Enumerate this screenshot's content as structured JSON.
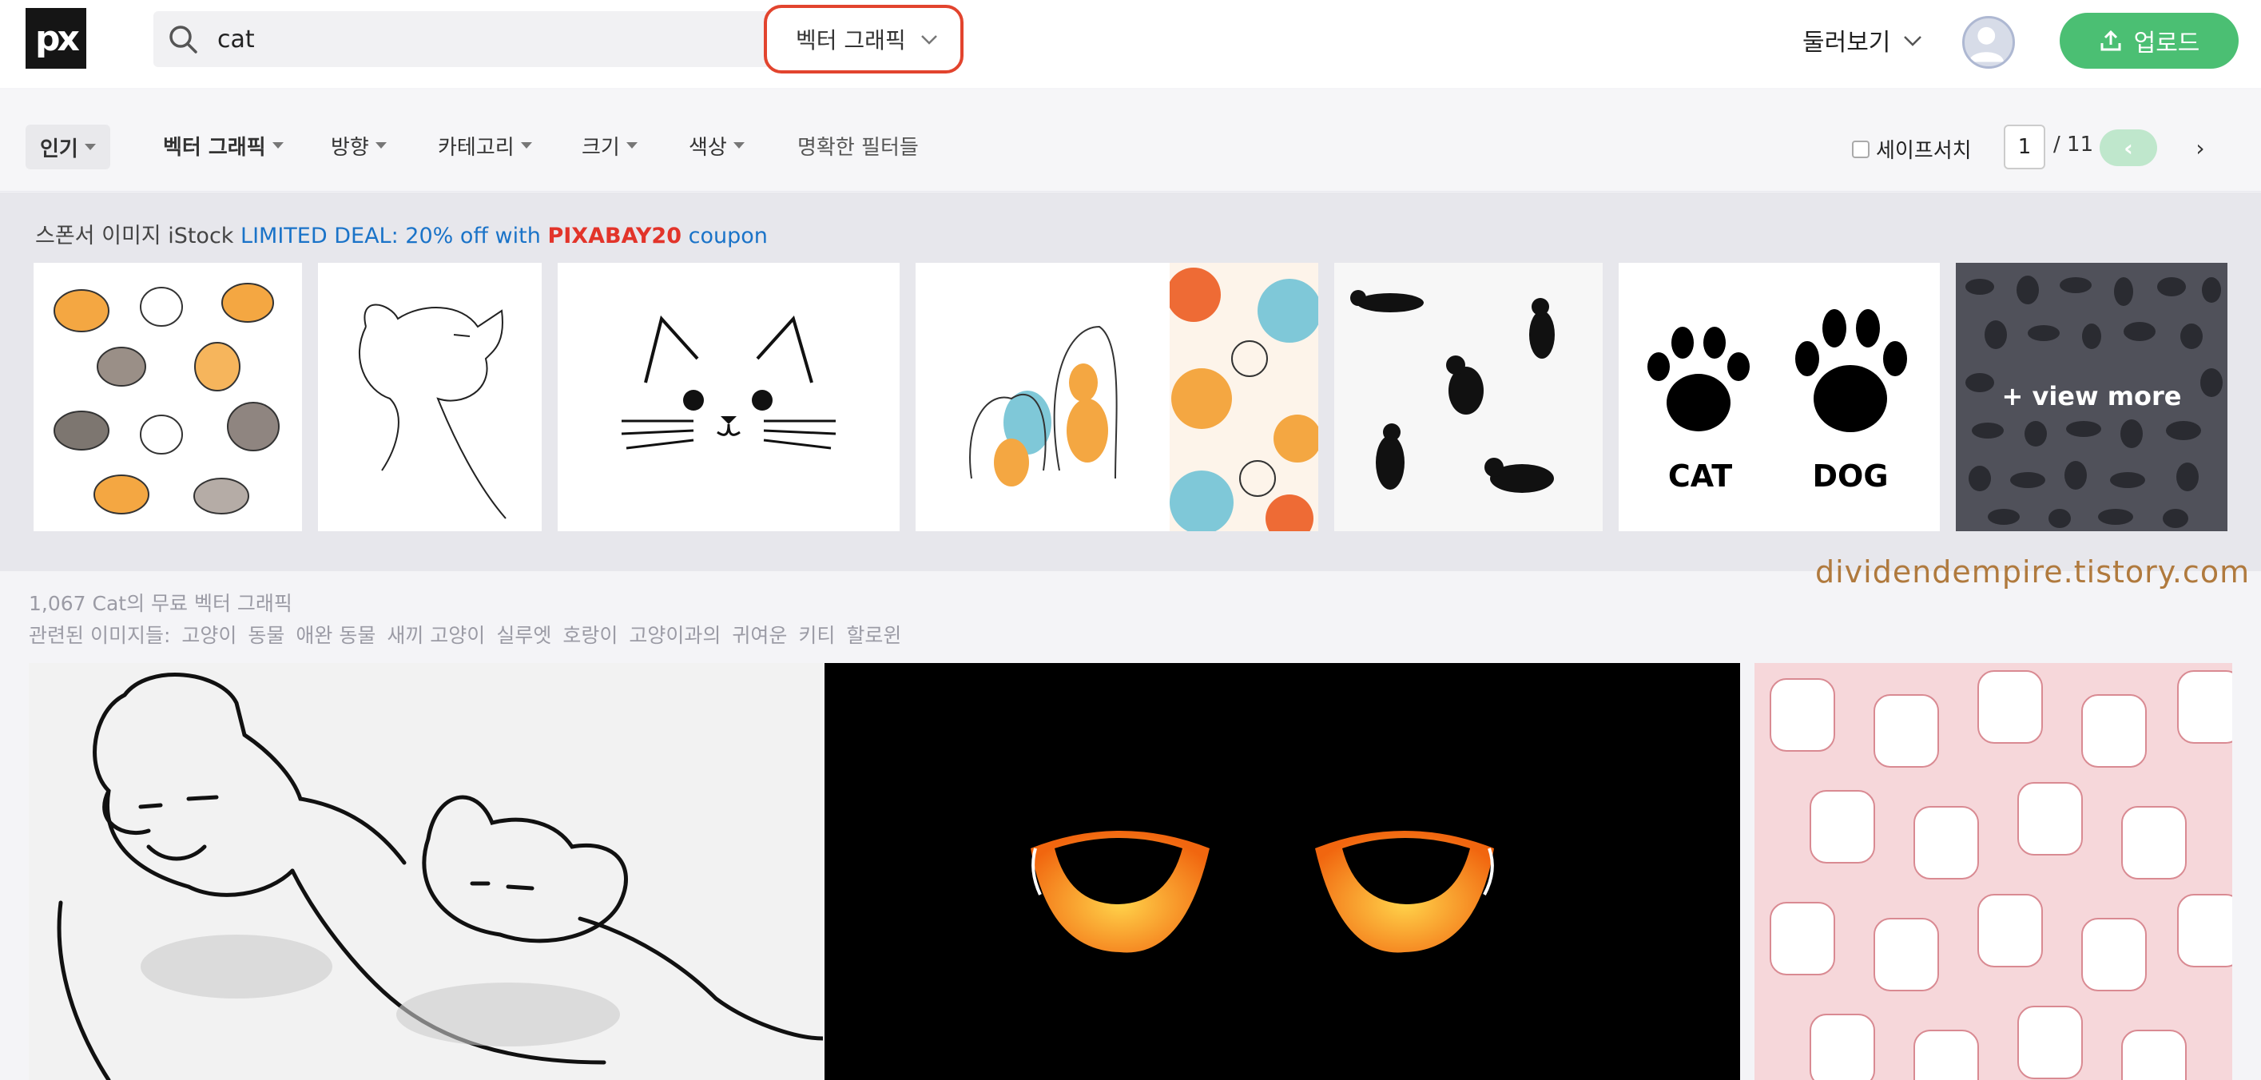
{
  "header": {
    "logo_text": "px",
    "search_value": "cat",
    "search_placeholder": "",
    "type_select": "벡터 그래픽",
    "browse_label": "둘러보기",
    "upload_label": "업로드"
  },
  "filters": {
    "items": [
      "인기",
      "벡터 그래픽",
      "방향",
      "카테고리",
      "크기",
      "색상",
      "명확한 필터들"
    ],
    "safesearch_label": "세이프서치",
    "safesearch_checked": false,
    "page_current": "1",
    "page_total": "/ 11",
    "prev_label": "‹",
    "next_label": "›"
  },
  "sponsor": {
    "prefix": "스폰서 이미지 iStock",
    "deal": "LIMITED DEAL: 20% off with",
    "code": "PIXABAY20",
    "suffix": "coupon",
    "paw_labels": [
      "CAT",
      "DOG"
    ],
    "view_more": "+ view more"
  },
  "results": {
    "count_text": "1,067 Cat의 무료 벡터 그래픽",
    "related_label": "관련된 이미지들:",
    "related_tags": [
      "고양이",
      "동물",
      "애완 동물",
      "새끼 고양이",
      "실루엣",
      "호랑이",
      "고양이과의",
      "귀여운",
      "키티",
      "할로윈"
    ]
  },
  "watermark": "dividendempire.tistory.com",
  "colors": {
    "accent_green": "#4bbf73",
    "highlight_red": "#e2442e",
    "link_blue": "#1a73c8"
  }
}
